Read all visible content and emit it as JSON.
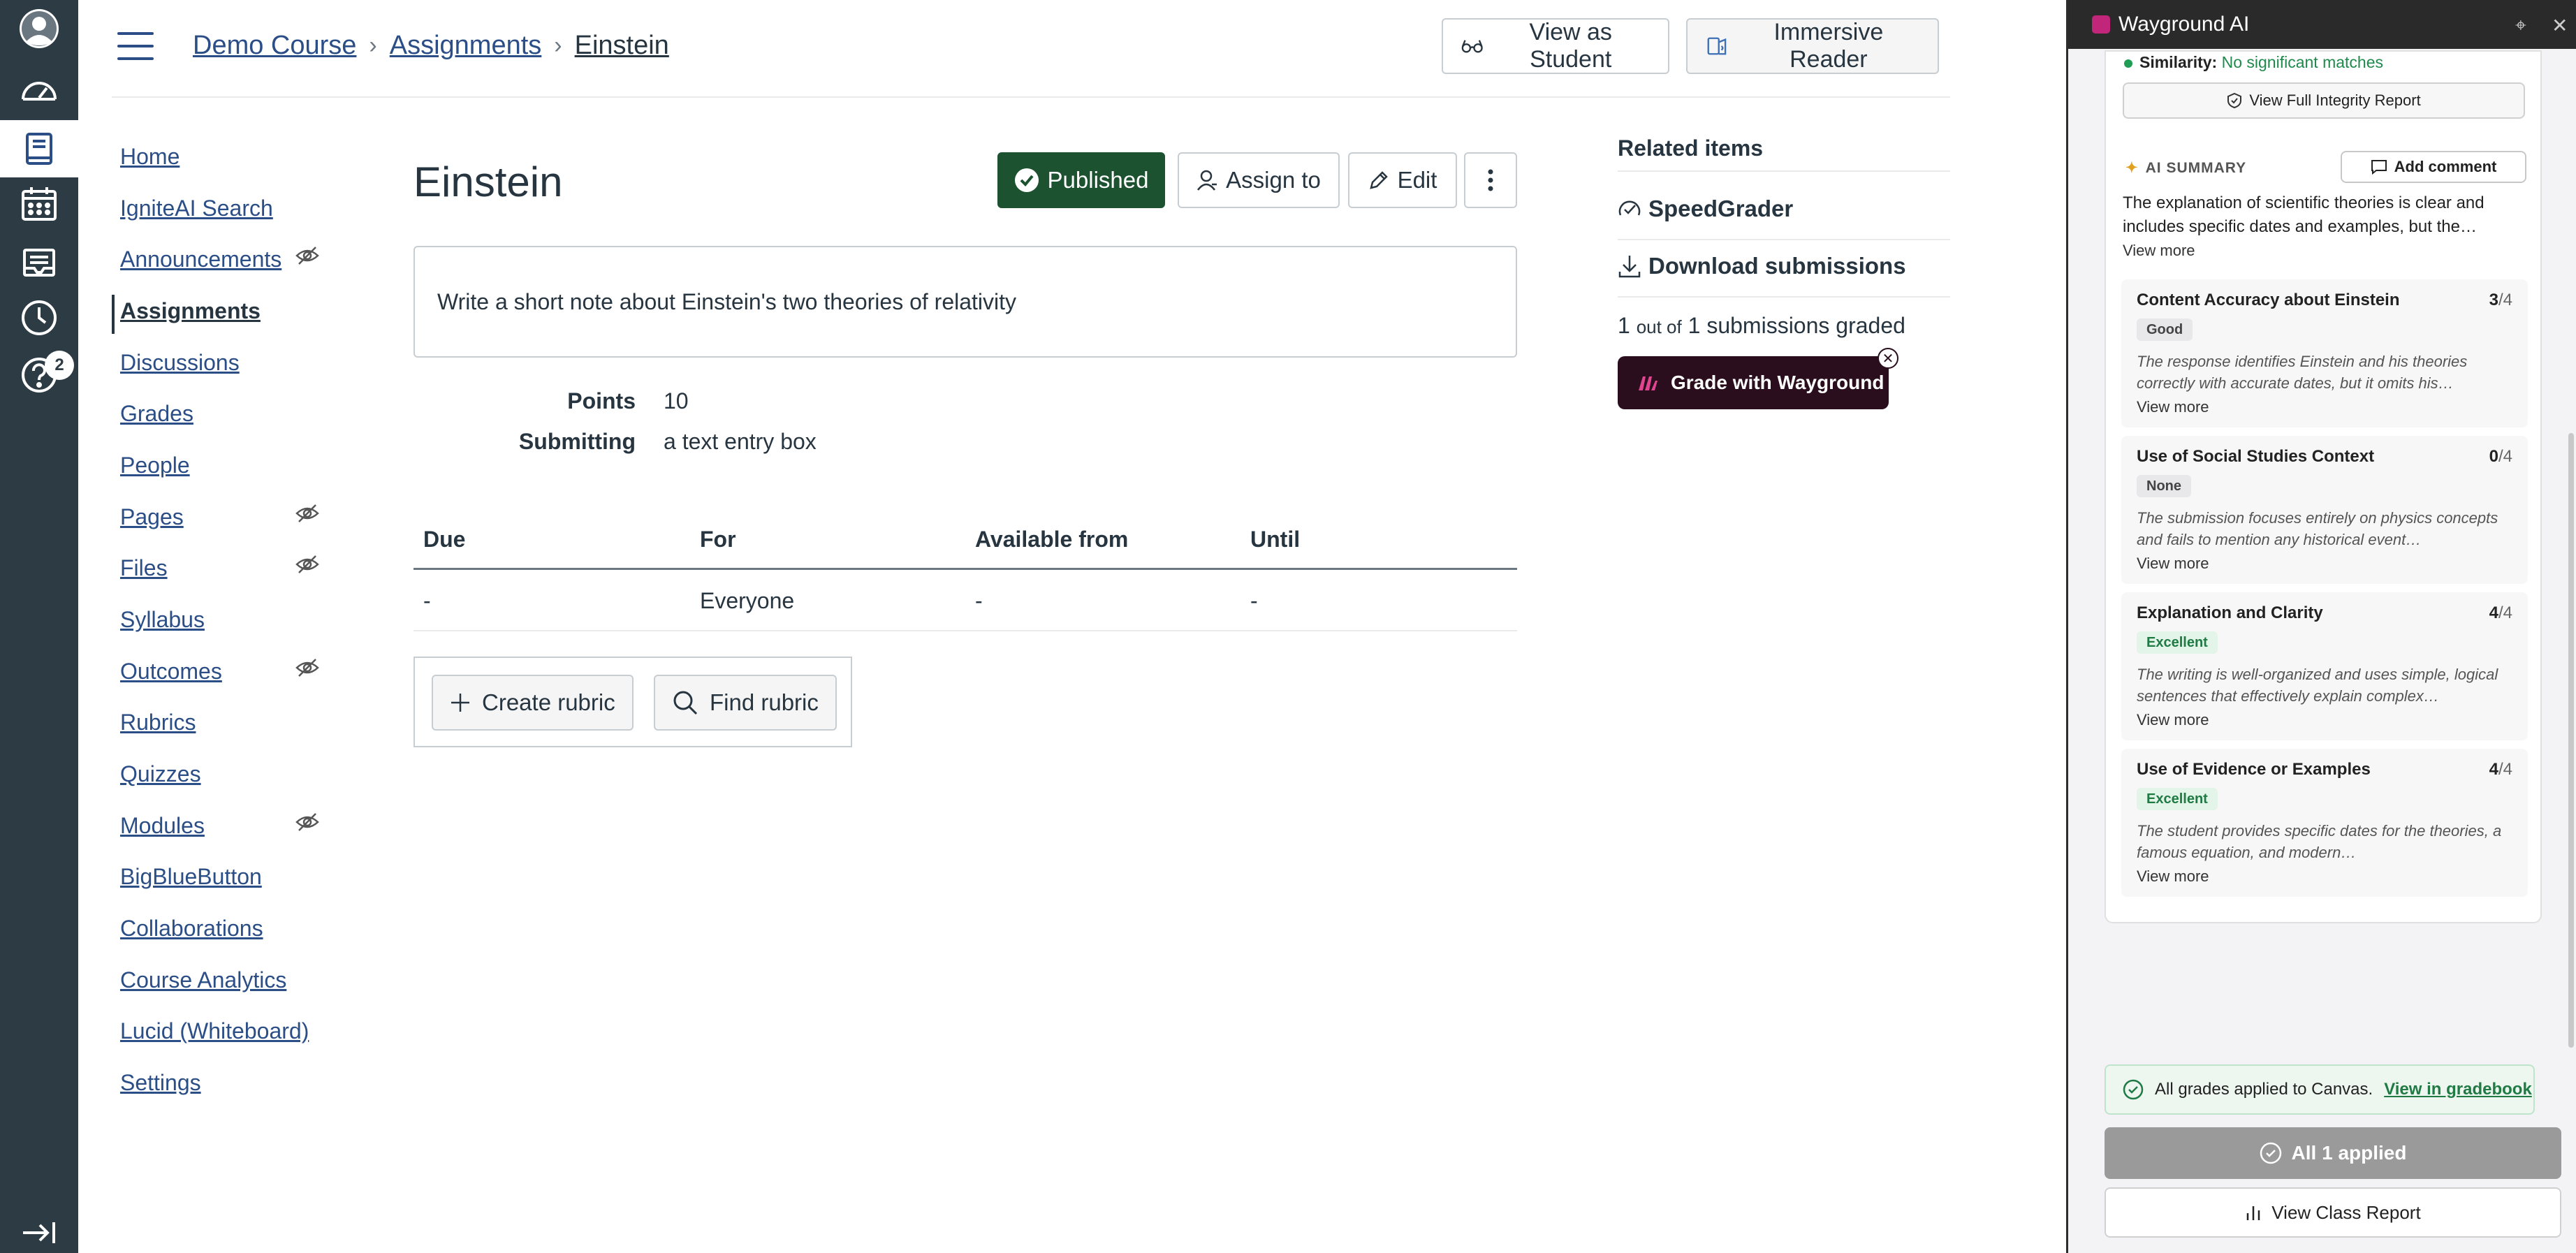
{
  "global_nav": {
    "items": [
      {
        "name": "account",
        "icon": "avatar-icon"
      },
      {
        "name": "dashboard",
        "icon": "dashboard-icon"
      },
      {
        "name": "courses",
        "icon": "book-icon",
        "active": true
      },
      {
        "name": "calendar",
        "icon": "calendar-icon"
      },
      {
        "name": "inbox",
        "icon": "inbox-icon"
      },
      {
        "name": "history",
        "icon": "clock-icon"
      },
      {
        "name": "help",
        "icon": "help-icon",
        "badge": "2"
      }
    ],
    "collapse_icon": "collapse-icon"
  },
  "breadcrumb": [
    "Demo Course",
    "Assignments",
    "Einstein"
  ],
  "header": {
    "view_as_student": "View as Student",
    "immersive_reader": "Immersive Reader"
  },
  "course_nav": {
    "items": [
      {
        "label": "Home"
      },
      {
        "label": "IgniteAI Search"
      },
      {
        "label": "Announcements",
        "hidden": true
      },
      {
        "label": "Assignments",
        "active": true
      },
      {
        "label": "Discussions"
      },
      {
        "label": "Grades"
      },
      {
        "label": "People"
      },
      {
        "label": "Pages",
        "hidden": true
      },
      {
        "label": "Files",
        "hidden": true
      },
      {
        "label": "Syllabus"
      },
      {
        "label": "Outcomes",
        "hidden": true
      },
      {
        "label": "Rubrics"
      },
      {
        "label": "Quizzes"
      },
      {
        "label": "Modules",
        "hidden": true
      },
      {
        "label": "BigBlueButton"
      },
      {
        "label": "Collaborations"
      },
      {
        "label": "Course Analytics"
      },
      {
        "label": "Lucid (Whiteboard)"
      },
      {
        "label": "Settings"
      }
    ]
  },
  "assignment": {
    "title": "Einstein",
    "published_label": "Published",
    "assign_to_label": "Assign to",
    "edit_label": "Edit",
    "description": "Write a short note about Einstein's two theories of relativity",
    "points_label": "Points",
    "points_value": "10",
    "submitting_label": "Submitting",
    "submitting_value": "a text entry box",
    "dates_headers": [
      "Due",
      "For",
      "Available from",
      "Until"
    ],
    "dates_row": [
      "-",
      "Everyone",
      "-",
      "-"
    ],
    "create_rubric": "Create rubric",
    "find_rubric": "Find rubric"
  },
  "related": {
    "title": "Related items",
    "speedgrader": "SpeedGrader",
    "download": "Download submissions",
    "graded_count": "1",
    "graded_out_of": "out of",
    "graded_total": "1 submissions graded",
    "grade_with_wayground": "Grade with Wayground"
  },
  "panel": {
    "title": "Wayground AI",
    "similarity_label": "Similarity:",
    "similarity_value": "No significant matches",
    "integrity_button": "View Full Integrity Report",
    "ai_summary_label": "AI SUMMARY",
    "add_comment": "Add comment",
    "ai_summary_text": "The explanation of scientific theories is clear and includes specific dates and examples, but the…",
    "view_more": "View more",
    "criteria": [
      {
        "title": "Content Accuracy about Einstein",
        "score": "3",
        "max": "/4",
        "rating": "Good",
        "rating_style": "gray",
        "text": "The response identifies Einstein and his theories correctly with accurate dates, but it omits his…"
      },
      {
        "title": "Use of Social Studies Context",
        "score": "0",
        "max": "/4",
        "rating": "None",
        "rating_style": "gray",
        "text": "The submission focuses entirely on physics concepts and fails to mention any historical event…"
      },
      {
        "title": "Explanation and Clarity",
        "score": "4",
        "max": "/4",
        "rating": "Excellent",
        "rating_style": "green",
        "text": "The writing is well-organized and uses simple, logical sentences that effectively explain complex…"
      },
      {
        "title": "Use of Evidence or Examples",
        "score": "4",
        "max": "/4",
        "rating": "Excellent",
        "rating_style": "green",
        "text": "The student provides specific dates for the theories, a famous equation, and modern…"
      }
    ],
    "grades_applied_text": "All grades applied to Canvas.",
    "gradebook_link": "View in gradebook",
    "all_applied": "All 1 applied",
    "class_report": "View Class Report"
  },
  "colors": {
    "nav_bg": "#2D3B45",
    "link": "#2B4E87",
    "published": "#1C5230",
    "wayground_btn": "#2A0E1E",
    "panel_header": "#2A2A2A"
  }
}
